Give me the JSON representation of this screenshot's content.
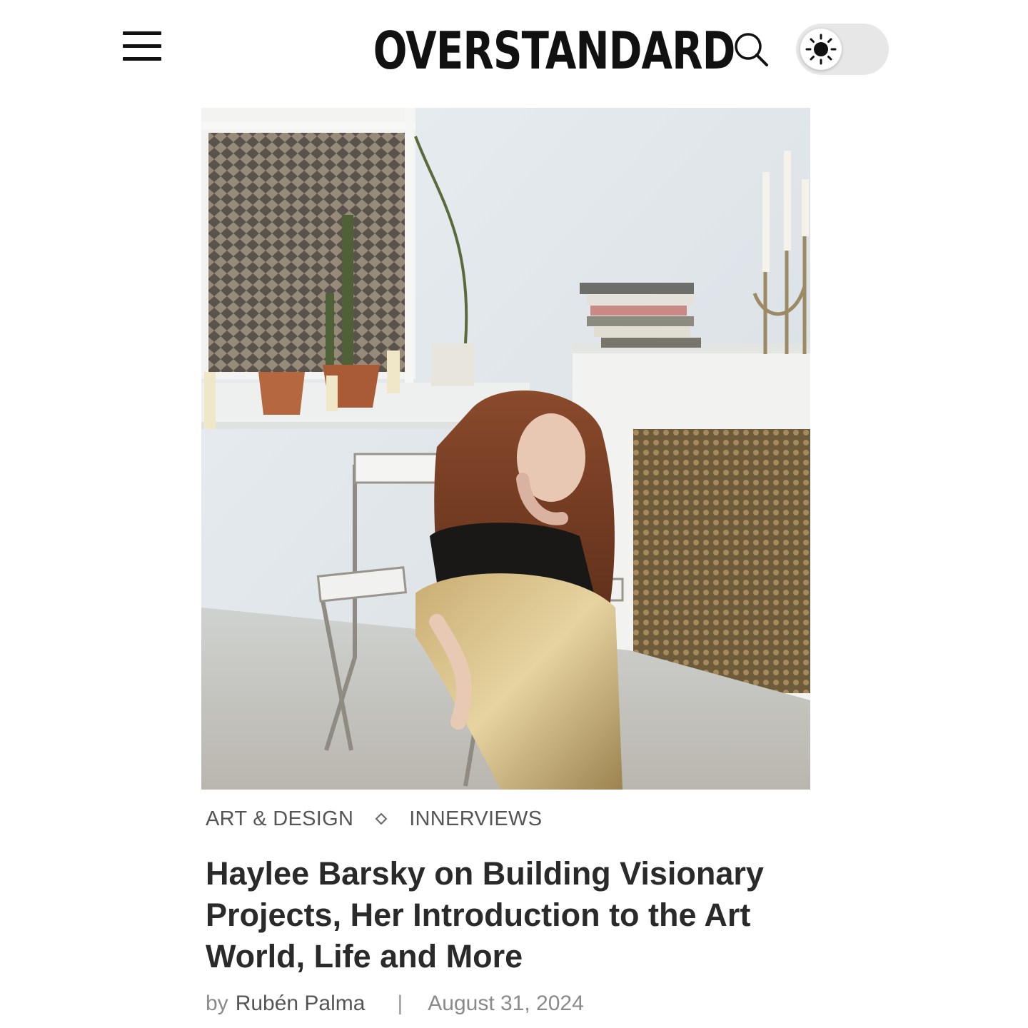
{
  "header": {
    "brand": "OVERSTANDARD",
    "menu_icon": "hamburger-menu-icon",
    "search_icon": "search-icon",
    "theme_icon": "sun-icon"
  },
  "hero": {
    "image_icon": "article-hero-photo"
  },
  "article": {
    "categories": [
      "ART & DESIGN",
      "INNERVIEWS"
    ],
    "category_separator_icon": "diamond-icon",
    "title": "Haylee Barsky on Building Visionary Projects, Her Introduction to the Art World, Life and More",
    "by_label": "by",
    "author": "Rubén Palma",
    "divider": "|",
    "date": "August 31, 2024"
  },
  "colors": {
    "text": "#2a2a2a",
    "muted": "#8a8a8a",
    "toggle_bg": "#e7e7e7"
  }
}
